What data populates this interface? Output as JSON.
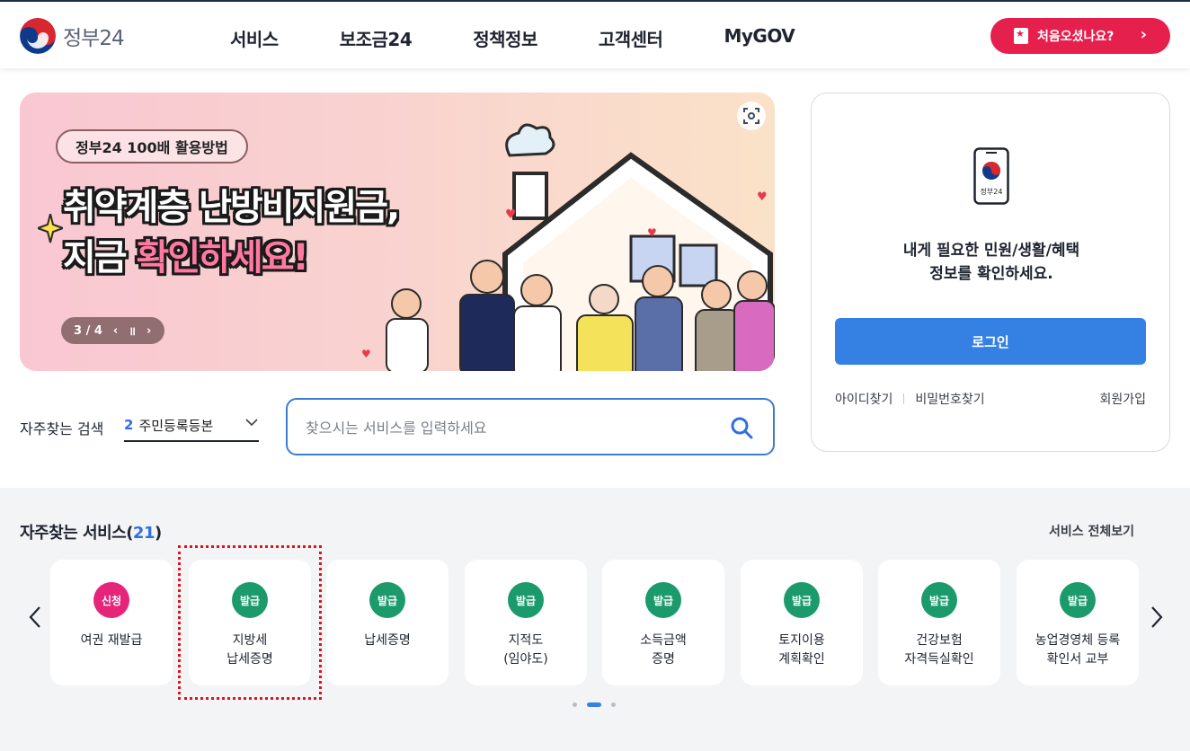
{
  "header": {
    "logo_text": "정부24",
    "nav": [
      "서비스",
      "보조금24",
      "정책정보",
      "고객센터",
      "MyGOV"
    ],
    "first_visit_button": "처음오셨나요?"
  },
  "banner": {
    "tag": "정부24 100배 활용방법",
    "title_line1_a": "취약계층 ",
    "title_line1_b": "난방비지원금,",
    "title_line2_a": "지금 ",
    "title_line2_b": "확인하세요!",
    "pager": "3 / 4"
  },
  "search": {
    "frequent_label": "자주찾는 검색",
    "frequent_rank": "2",
    "frequent_value": "주민등록등본",
    "placeholder": "찾으시는 서비스를 입력하세요"
  },
  "login": {
    "phone_label": "정부24",
    "message_line1": "내게 필요한 민원/생활/혜택",
    "message_line2": "정보를 확인하세요.",
    "login_button": "로그인",
    "find_id": "아이디찾기",
    "find_password": "비밀번호찾기",
    "join": "회원가입"
  },
  "services": {
    "title": "자주찾는 서비스",
    "count": "21",
    "view_all": "서비스 전체보기",
    "items": [
      {
        "badge": "신청",
        "type": "apply",
        "name": "여권 재발급"
      },
      {
        "badge": "발급",
        "type": "issue",
        "name": "지방세\n납세증명"
      },
      {
        "badge": "발급",
        "type": "issue",
        "name": "납세증명"
      },
      {
        "badge": "발급",
        "type": "issue",
        "name": "지적도\n(임야도)"
      },
      {
        "badge": "발급",
        "type": "issue",
        "name": "소득금액\n증명"
      },
      {
        "badge": "발급",
        "type": "issue",
        "name": "토지이용\n계획확인"
      },
      {
        "badge": "발급",
        "type": "issue",
        "name": "건강보험\n자격득실확인"
      },
      {
        "badge": "발급",
        "type": "issue",
        "name": "농업경영체 등록\n확인서 교부"
      }
    ]
  },
  "colors": {
    "accent_blue": "#3581e3",
    "brand_red": "#e6204c",
    "apply_badge": "#e6247a",
    "issue_badge": "#1b9a6c",
    "highlight_border": "#e3101f"
  }
}
